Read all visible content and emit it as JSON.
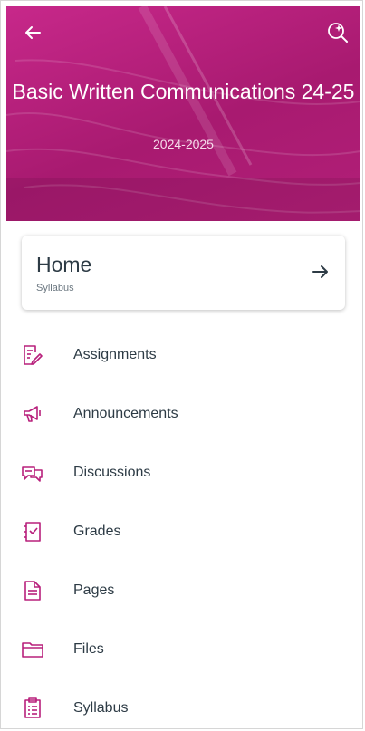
{
  "header": {
    "course_title": "Basic Written Communications 24-25",
    "term": "2024-2025",
    "back_icon": "arrow-left-icon",
    "search_icon": "search-sparkle-icon",
    "brand_color": "#b8207c"
  },
  "home_card": {
    "title": "Home",
    "subtitle": "Syllabus",
    "arrow_icon": "arrow-right-icon"
  },
  "nav": {
    "items": [
      {
        "label": "Assignments",
        "icon": "assignment-icon"
      },
      {
        "label": "Announcements",
        "icon": "announcement-icon"
      },
      {
        "label": "Discussions",
        "icon": "discussion-icon"
      },
      {
        "label": "Grades",
        "icon": "grades-icon"
      },
      {
        "label": "Pages",
        "icon": "page-icon"
      },
      {
        "label": "Files",
        "icon": "folder-icon"
      },
      {
        "label": "Syllabus",
        "icon": "syllabus-icon"
      }
    ],
    "icon_color": "#b8207c"
  }
}
